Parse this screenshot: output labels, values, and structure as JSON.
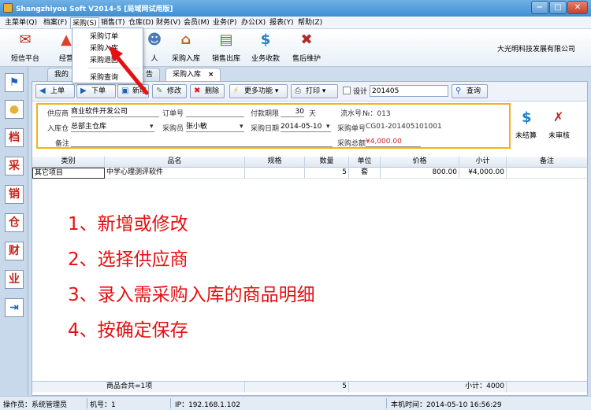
{
  "window": {
    "title": "Shangzhiyou Soft V2014-5 [局域网试用版]",
    "controls": [
      "−",
      "□",
      "✕"
    ]
  },
  "menu": [
    "主菜单(Q)",
    "档案(F)",
    "采购(S)",
    "销售(T)",
    "仓库(D)",
    "财务(V)",
    "会员(M)",
    "业务(P)",
    "办公(X)",
    "报表(Y)",
    "帮助(Z)"
  ],
  "purchase_menu": [
    "采购订单",
    "采购入库",
    "采购退回",
    "采购查询"
  ],
  "toolbar": [
    {
      "label": "短信平台",
      "icon": "mail-icon"
    },
    {
      "label": "经营",
      "icon": "chart-icon"
    },
    {
      "label": "人",
      "icon": "person-icon"
    },
    {
      "label": "采购入库",
      "icon": "house-icon"
    },
    {
      "label": "销售出库",
      "icon": "doc-icon"
    },
    {
      "label": "业务收款",
      "icon": "dollar-icon"
    },
    {
      "label": "售后维护",
      "icon": "tools-icon"
    }
  ],
  "company": "大光明科技发展有限公司",
  "sidebar": [
    "⚑",
    "●",
    "档",
    "采",
    "销",
    "仓",
    "财",
    "业",
    "⇥"
  ],
  "tabs": {
    "home": "我的",
    "partial": "告",
    "active": "采购入库",
    "close": "×"
  },
  "controls": {
    "prev": "上单",
    "next": "下单",
    "new": "新增",
    "edit": "修改",
    "delete": "删除",
    "more": "更多功能",
    "print": "打印",
    "design": "设计",
    "search_value": "201405",
    "query": "查询"
  },
  "form": {
    "supplier_label": "供应商",
    "supplier": "商业软件开发公司",
    "order_no_label": "订单号",
    "order_no": "",
    "payment_term_label": "付款期限",
    "payment_term": "30",
    "payment_unit": "天",
    "serial_label": "流水号",
    "serial": "№：013",
    "warehouse_label": "入库仓",
    "warehouse": "总部主仓库",
    "buyer_label": "采购员",
    "buyer": "张小敏",
    "date_label": "采购日期",
    "date": "2014-05-10",
    "doc_no_label": "采购单号",
    "doc_no": "CG01-201405101001",
    "note_label": "备注",
    "note": "",
    "total_label": "采购总额",
    "total": "¥4,000.00",
    "unsettled": "未结算",
    "unaudited": "未审核"
  },
  "table": {
    "headers": [
      "类别",
      "品名",
      "规格",
      "数量",
      "单位",
      "价格",
      "小计",
      "备注"
    ],
    "rows": [
      [
        "其它项目",
        "中学心理测评软件",
        "",
        "5",
        "套",
        "800.00",
        "¥4,000.00",
        ""
      ]
    ],
    "footer": {
      "summary": "商品合共=1项",
      "qty": "5",
      "subtotal": "小计：4000"
    }
  },
  "instructions": [
    "1、新增或修改",
    "2、选择供应商",
    "3、录入需采购入库的商品明细",
    "4、按确定保存"
  ],
  "statusbar": {
    "operator": "操作员：系统管理员",
    "machine": "机号：1",
    "ip": "IP：192.168.1.102",
    "time": "本机时间：2014-05-10 16:56:29"
  }
}
